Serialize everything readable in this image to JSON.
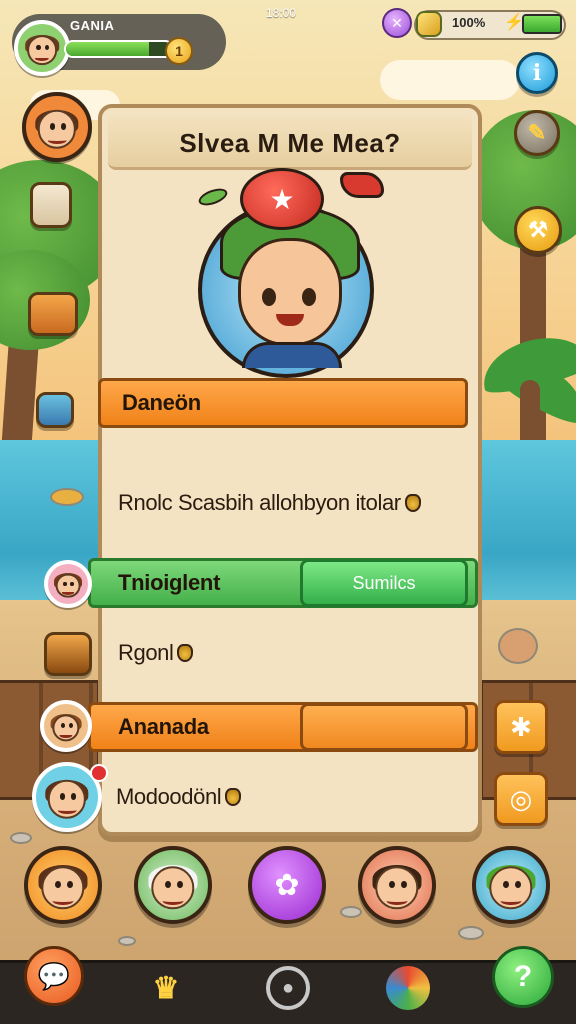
{
  "status_bar": {
    "clock": "18:00",
    "battery_text": "100%",
    "battery_level": 1.0
  },
  "player": {
    "name": "GANIA",
    "xp_fraction": 0.78,
    "level_badge": "1"
  },
  "dialog": {
    "title": "Slvea M Me Mea?",
    "sections": [
      {
        "label": "Daneön",
        "style": "orange"
      },
      {
        "text": "Rnolc Scasbih allohbyon itolar"
      },
      {
        "label": "Tnioiglent",
        "style": "green",
        "button": "Sumilcs"
      },
      {
        "text": "Rgonl"
      },
      {
        "label": "Ananada",
        "style": "orange",
        "button": ""
      },
      {
        "text": "Modoodönl"
      }
    ]
  },
  "icons": {
    "info": "i",
    "star": "★",
    "bolt": "⚡",
    "gem": "✕"
  },
  "colors": {
    "accent_orange": "#f08218",
    "accent_green": "#43b04a",
    "panel_bg": "#f3e3c2",
    "water": "#3aa6c6"
  }
}
